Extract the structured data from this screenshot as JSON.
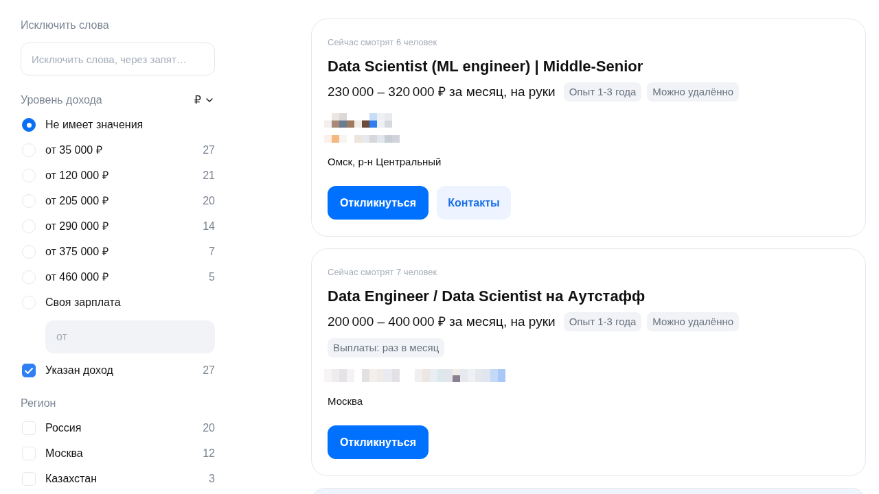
{
  "filters": {
    "exclude_words": {
      "label": "Исключить слова",
      "placeholder": "Исключить слова, через запят…"
    },
    "income": {
      "label": "Уровень дохода",
      "currency": "₽",
      "options": [
        {
          "label": "Не имеет значения",
          "selected": true
        },
        {
          "label": "от 35 000 ₽",
          "count": "27",
          "selected": false
        },
        {
          "label": "от 120 000 ₽",
          "count": "21",
          "selected": false
        },
        {
          "label": "от 205 000 ₽",
          "count": "20",
          "selected": false
        },
        {
          "label": "от 290 000 ₽",
          "count": "14",
          "selected": false
        },
        {
          "label": "от 375 000 ₽",
          "count": "7",
          "selected": false
        },
        {
          "label": "от 460 000 ₽",
          "count": "5",
          "selected": false
        },
        {
          "label": "Своя зарплата",
          "selected": false
        }
      ],
      "custom_salary": {
        "placeholder": "от"
      },
      "salary_specified": {
        "label": "Указан доход",
        "count": "27",
        "checked": true
      }
    },
    "region": {
      "label": "Регион",
      "items": [
        {
          "label": "Россия",
          "count": "20",
          "checked": false
        },
        {
          "label": "Москва",
          "count": "12",
          "checked": false
        },
        {
          "label": "Казахстан",
          "count": "3",
          "checked": false
        }
      ]
    }
  },
  "vacancies": [
    {
      "viewers": "Сейчас смотрят 6 человек",
      "title": "Data Scientist (ML engineer) | Middle-Senior",
      "salary": "230 000 – 320 000 ₽ за месяц, на руки",
      "tags": [
        "Опыт 1-3 года",
        "Можно удалённо"
      ],
      "location": "Омск, р-н Центральный",
      "buttons": [
        {
          "label": "Откликнуться",
          "kind": "primary"
        },
        {
          "label": "Контакты",
          "kind": "secondary"
        }
      ]
    },
    {
      "viewers": "Сейчас смотрят 7 человек",
      "title": "Data Engineer / Data Scientist на Аутстафф",
      "salary": "200 000 – 400 000 ₽ за месяц, на руки",
      "tags": [
        "Опыт 1-3 года",
        "Можно удалённо"
      ],
      "extra_tags": [
        "Выплаты: раз в месяц"
      ],
      "location": "Москва",
      "buttons": [
        {
          "label": "Откликнуться",
          "kind": "primary"
        }
      ]
    }
  ]
}
